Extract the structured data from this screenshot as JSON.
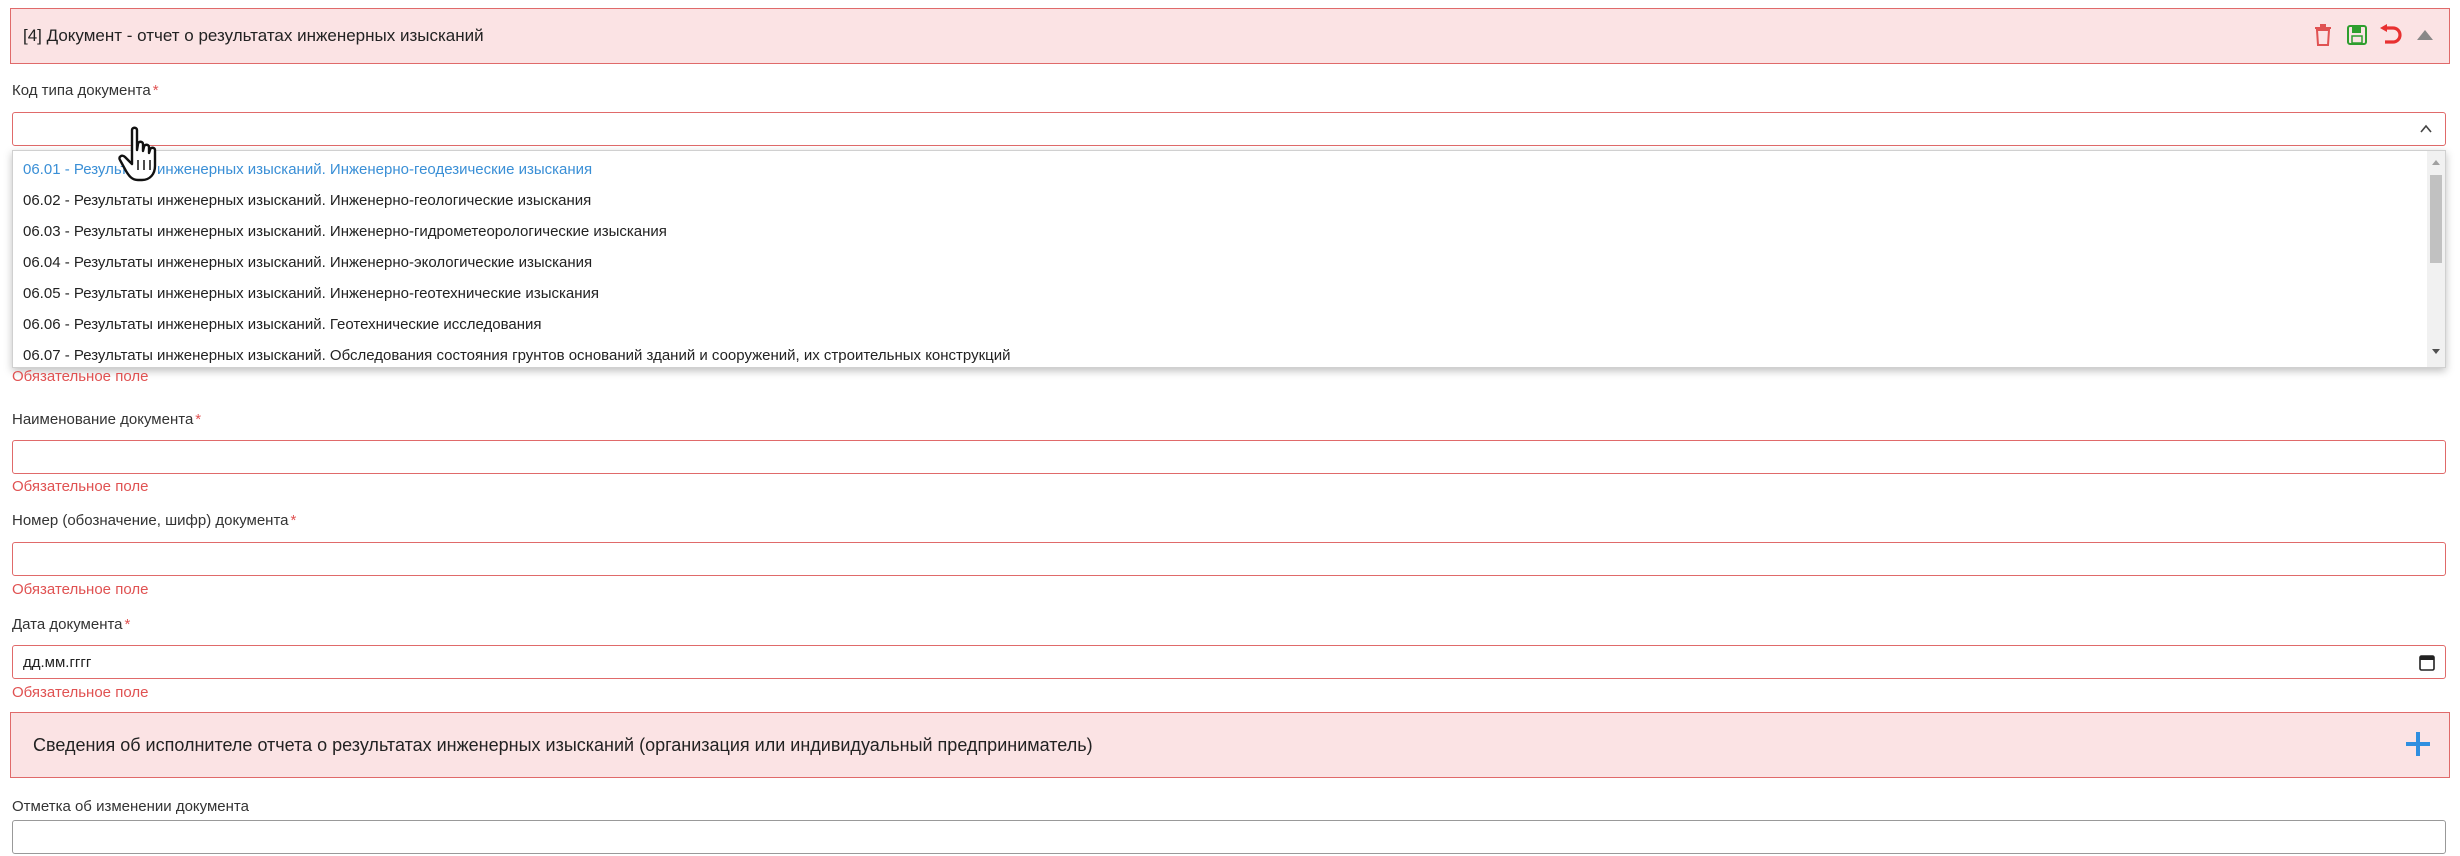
{
  "header": {
    "title": "[4] Документ - отчет о результатах инженерных изысканий",
    "icons": [
      "trash-icon",
      "save-icon",
      "undo-icon",
      "collapse-icon"
    ]
  },
  "colors": {
    "accent_red": "#e06a6a",
    "panel_bg": "#fbe3e4",
    "link_blue": "#3a8fd6",
    "save_green": "#2e9e2e",
    "plus_blue": "#2f8fe0"
  },
  "fields": {
    "doc_type_code": {
      "label": "Код типа документа",
      "required_mark": "*",
      "value": "",
      "error": "Обязательное поле"
    },
    "doc_name": {
      "label": "Наименование документа",
      "required_mark": "*",
      "value": "",
      "error": "Обязательное поле"
    },
    "doc_number": {
      "label": "Номер (обозначение, шифр) документа",
      "required_mark": "*",
      "value": "",
      "error": "Обязательное поле"
    },
    "doc_date": {
      "label": "Дата документа",
      "required_mark": "*",
      "placeholder": "дд.мм.гггг",
      "error": "Обязательное поле"
    },
    "change_note": {
      "label": "Отметка об изменении документа",
      "value": ""
    }
  },
  "dropdown": {
    "options": [
      "06.01 - Результаты инженерных изысканий. Инженерно-геодезические изыскания",
      "06.02 - Результаты инженерных изысканий. Инженерно-геологические изыскания",
      "06.03 - Результаты инженерных изысканий. Инженерно-гидрометеорологические изыскания",
      "06.04 - Результаты инженерных изысканий. Инженерно-экологические изыскания",
      "06.05 - Результаты инженерных изысканий. Инженерно-геотехнические изыскания",
      "06.06 - Результаты инженерных изысканий. Геотехнические исследования",
      "06.07 - Результаты инженерных изысканий. Обследования состояния грунтов оснований зданий и сооружений, их строительных конструкций"
    ],
    "highlighted_index": 0
  },
  "section": {
    "title": "Сведения об исполнителе отчета о результатах инженерных изысканий (организация или индивидуальный предприниматель)",
    "add_icon": "plus-icon"
  }
}
